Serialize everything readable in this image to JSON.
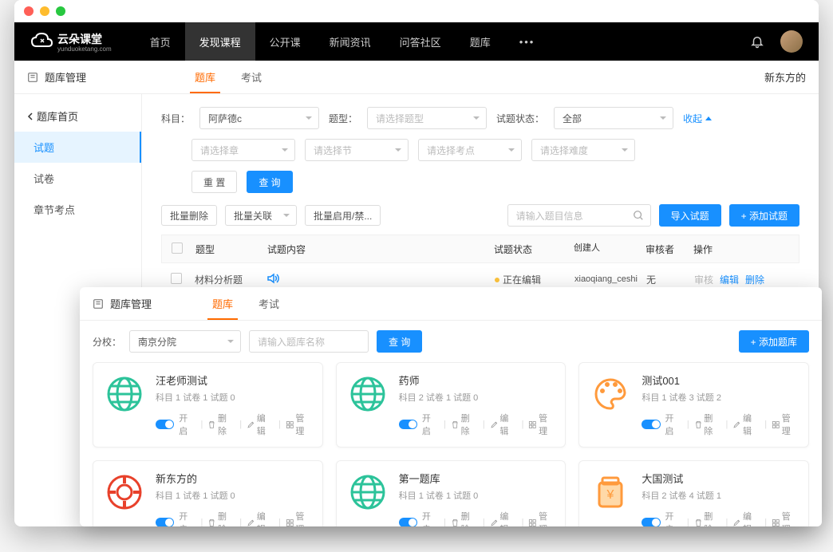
{
  "logo": {
    "name": "云朵课堂",
    "sub": "yunduoketang.com"
  },
  "nav": {
    "items": [
      "首页",
      "发现课程",
      "公开课",
      "新闻资讯",
      "问答社区",
      "题库"
    ],
    "active": 1
  },
  "subheader": {
    "title": "题库管理",
    "tabs": [
      "题库",
      "考试"
    ],
    "active": 0,
    "right": "新东方的"
  },
  "sidebar": {
    "back": "题库首页",
    "items": [
      "试题",
      "试卷",
      "章节考点"
    ],
    "active": 0
  },
  "filters": {
    "l_subject": "科目：",
    "subject": "阿萨德c",
    "l_type": "题型：",
    "type_ph": "请选择题型",
    "l_status": "试题状态：",
    "status": "全部",
    "collapse": "收起",
    "chapter_ph": "请选择章",
    "section_ph": "请选择节",
    "point_ph": "请选择考点",
    "difficulty_ph": "请选择难度",
    "reset": "重 置",
    "query": "查 询"
  },
  "actions": {
    "bulk_delete": "批量删除",
    "bulk_link": "批量关联",
    "bulk_toggle": "批量启用/禁...",
    "search_ph": "请输入题目信息",
    "import": "导入试题",
    "add": "+ 添加试题"
  },
  "table": {
    "headers": {
      "type": "题型",
      "content": "试题内容",
      "status": "试题状态",
      "creator": "创建人",
      "reviewer": "审核者",
      "ops": "操作"
    },
    "row": {
      "type": "材料分析题",
      "status": "正在编辑",
      "creator": "xiaoqiang_ceshi",
      "reviewer": "无",
      "ops": [
        "审核",
        "编辑",
        "删除"
      ]
    }
  },
  "overlay": {
    "title": "题库管理",
    "tabs": [
      "题库",
      "考试"
    ],
    "active": 0,
    "l_branch": "分校：",
    "branch": "南京分院",
    "name_ph": "请输入题库名称",
    "query": "查 询",
    "add": "+ 添加题库",
    "card_labels": {
      "on": "开启",
      "del": "删除",
      "edit": "编辑",
      "manage": "管理"
    },
    "cards": [
      {
        "title": "汪老师测试",
        "meta": "科目 1  试卷 1  试题 0",
        "icon": "globe-green"
      },
      {
        "title": "药师",
        "meta": "科目 2  试卷 1  试题 0",
        "icon": "globe-green"
      },
      {
        "title": "测试001",
        "meta": "科目 1  试卷 3  试题 2",
        "icon": "palette"
      },
      {
        "title": "新东方的",
        "meta": "科目 1  试卷 1  试题 0",
        "icon": "coin-red"
      },
      {
        "title": "第一题库",
        "meta": "科目 1  试卷 1  试题 0",
        "icon": "globe-green"
      },
      {
        "title": "大国测试",
        "meta": "科目 2  试卷 4  试题 1",
        "icon": "jar-orange"
      }
    ]
  }
}
